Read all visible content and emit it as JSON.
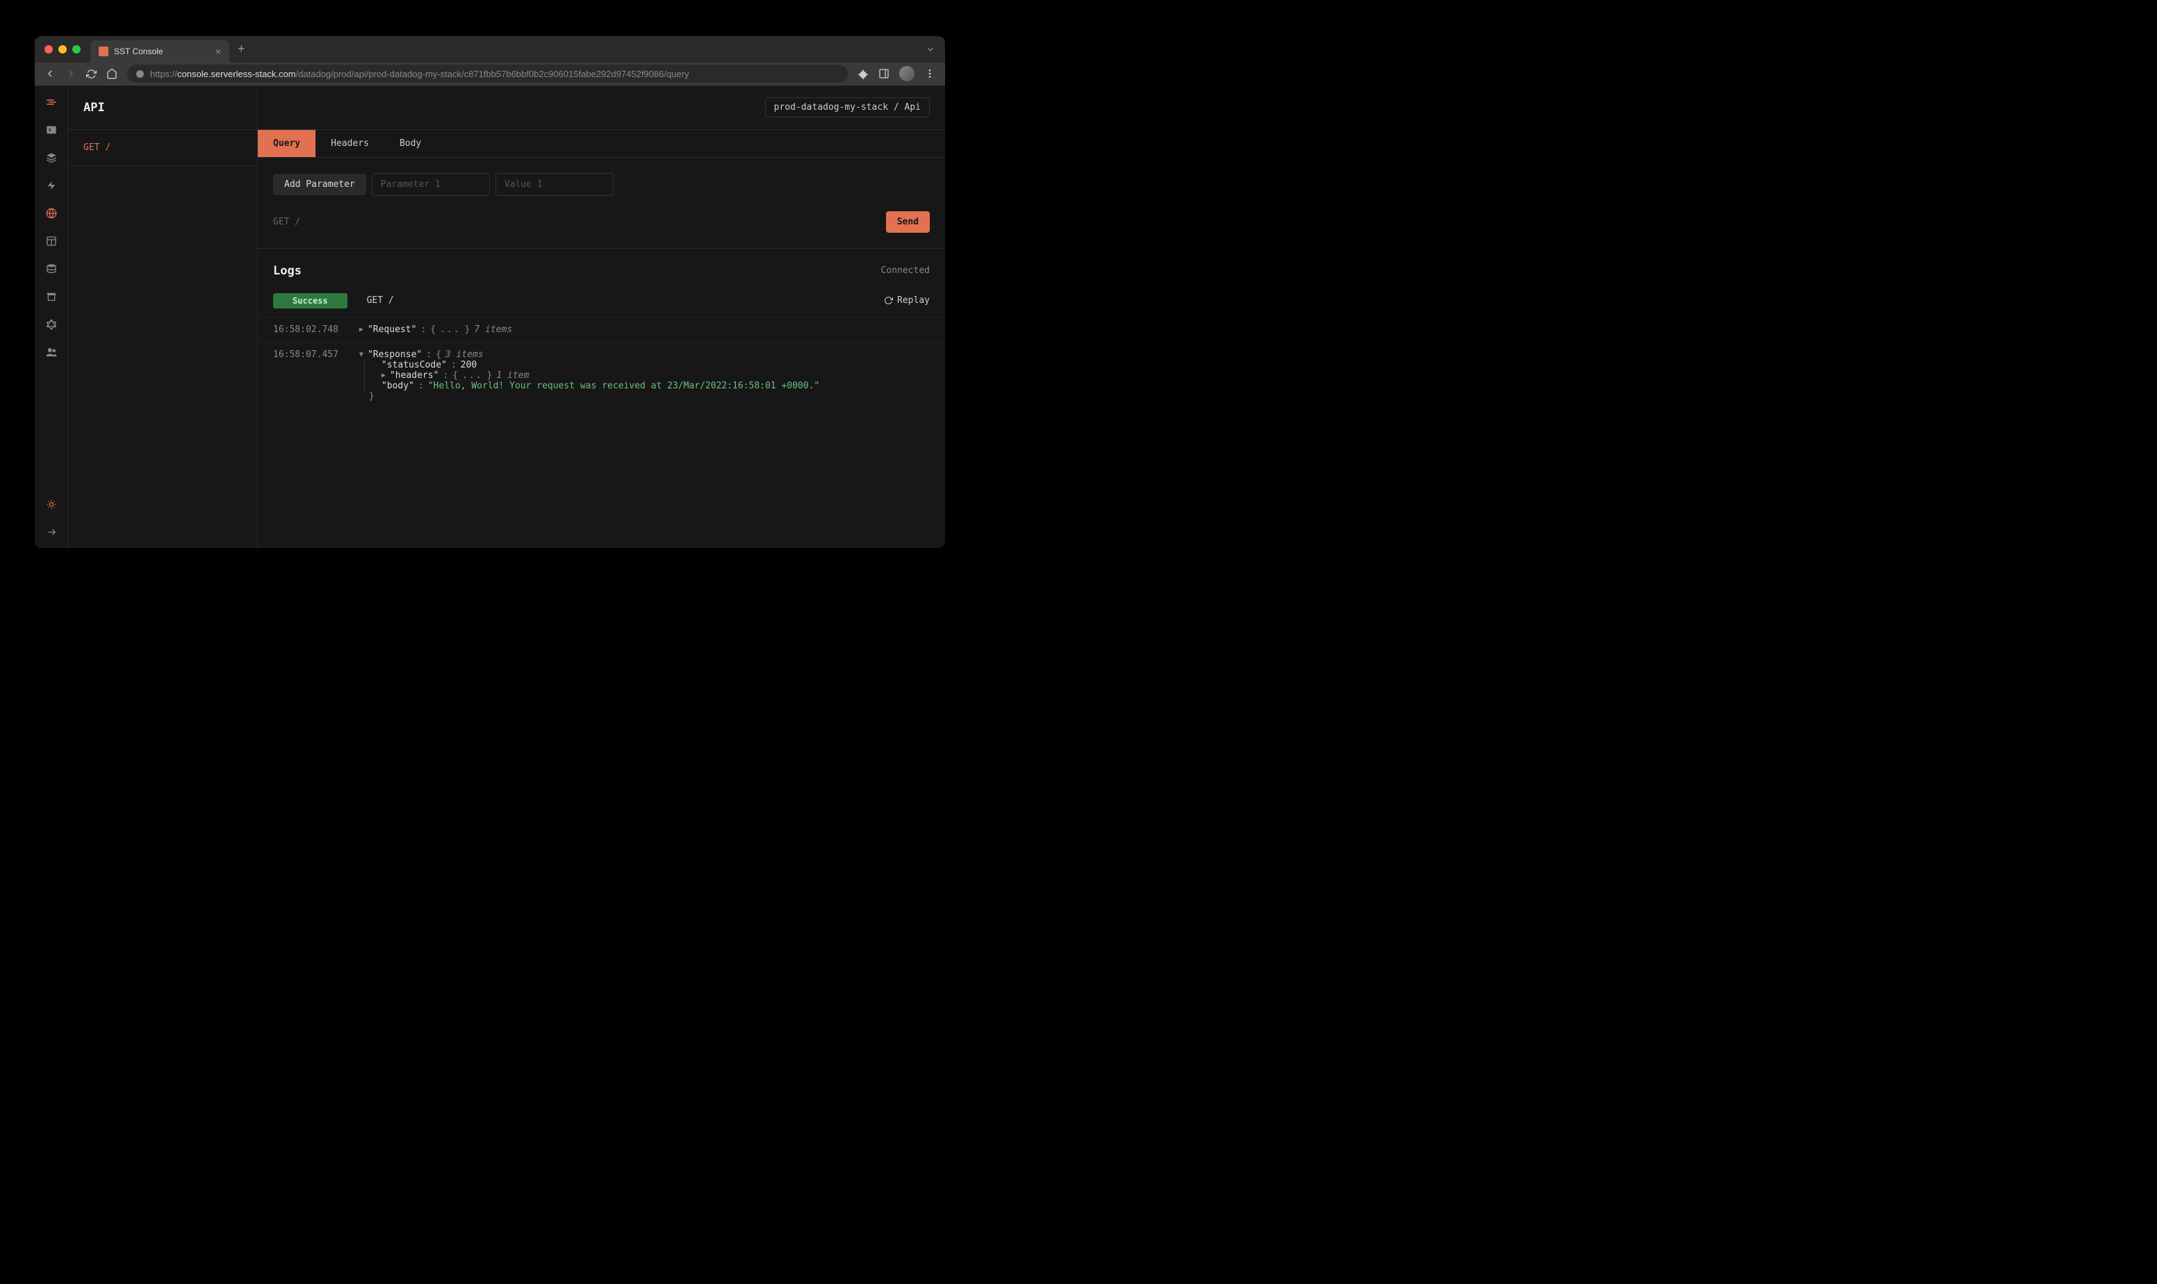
{
  "browser": {
    "tab_title": "SST Console",
    "url_prefix": "https://",
    "url_domain": "console.serverless-stack.com",
    "url_path": "/datadog/prod/api/prod-datadog-my-stack/c871fbb57b6bbf0b2c906015fabe292d97452f9086/query"
  },
  "page": {
    "title": "API",
    "breadcrumb": "prod-datadog-my-stack / Api"
  },
  "routes": [
    {
      "method": "GET",
      "path": "/"
    }
  ],
  "tabs": {
    "query": "Query",
    "headers": "Headers",
    "body": "Body"
  },
  "params": {
    "add_button": "Add Parameter",
    "name_placeholder": "Parameter 1",
    "value_placeholder": "Value 1"
  },
  "request": {
    "label": "GET /",
    "send": "Send"
  },
  "logs": {
    "title": "Logs",
    "connected": "Connected",
    "success": "Success",
    "route": "GET /",
    "replay": "Replay",
    "entries": [
      {
        "ts": "16:58:02.748",
        "key": "Request",
        "item_count": "7 items"
      },
      {
        "ts": "16:58:07.457",
        "key": "Response",
        "item_count": "3 items",
        "children": {
          "statusCode": 200,
          "headers_count": "1 item",
          "body": "\"Hello, World! Your request was received at 23/Mar/2022:16:58:01 +0000.\""
        }
      }
    ]
  }
}
